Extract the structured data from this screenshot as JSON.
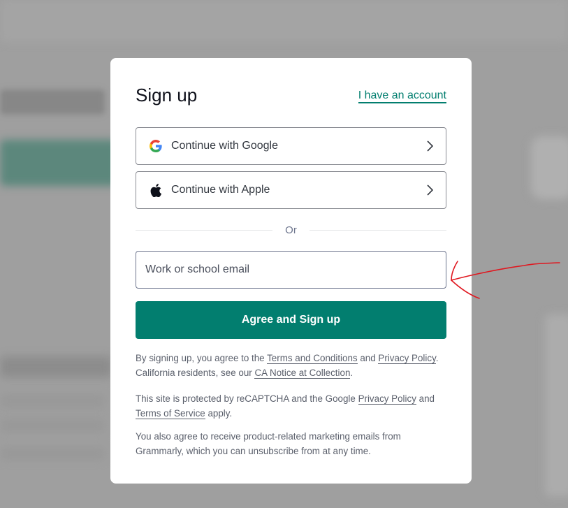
{
  "modal": {
    "title": "Sign up",
    "have_account_link": "I have an account",
    "google_button": "Continue with Google",
    "apple_button": "Continue with Apple",
    "divider_text": "Or",
    "email_placeholder": "Work or school email",
    "email_value": "",
    "submit_button": "Agree and Sign up",
    "legal1": {
      "t1": "By signing up, you agree to the ",
      "terms": "Terms and Conditions",
      "t2": " and ",
      "privacy": "Privacy Policy",
      "t3": ". California residents, see our ",
      "ca_notice": "CA Notice at Collection",
      "t4": "."
    },
    "legal2": {
      "t1": "This site is protected by reCAPTCHA and the Google ",
      "privacy": "Privacy Policy",
      "t2": " and ",
      "terms": "Terms of Service",
      "t3": " apply."
    },
    "legal3": "You also agree to receive product-related marketing emails from Grammarly, which you can unsubscribe from at any time."
  },
  "colors": {
    "accent": "#027e6f",
    "annotation_arrow": "#e0171f",
    "backdrop": "#a3a3a3"
  },
  "icons": [
    "google-icon",
    "apple-icon",
    "chevron-right-icon"
  ]
}
